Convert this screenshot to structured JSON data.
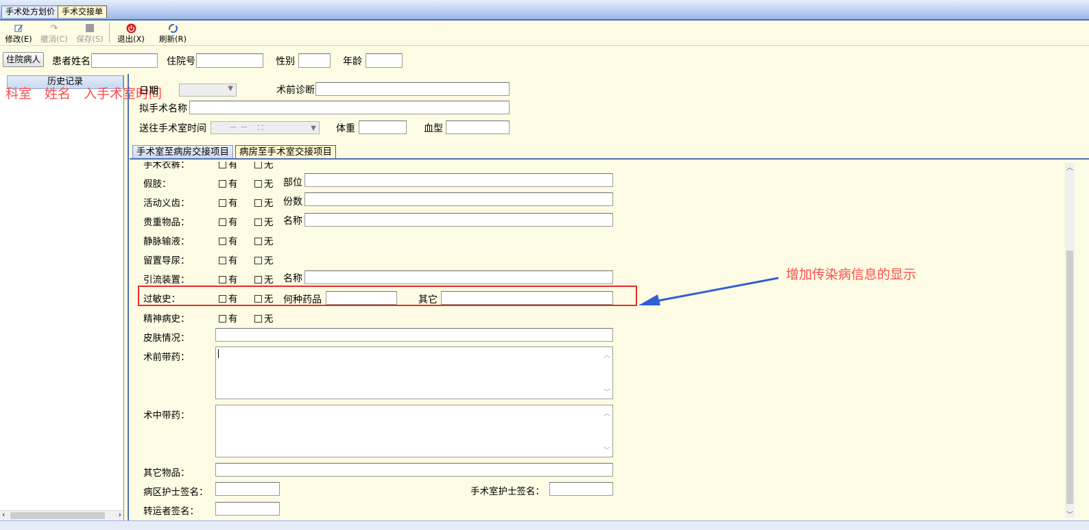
{
  "top_tabs": [
    {
      "label": "手术处方划价",
      "active": false
    },
    {
      "label": "手术交接单",
      "active": true
    }
  ],
  "toolbar": {
    "edit": {
      "label": "修改(E)",
      "icon": "edit-icon"
    },
    "undo": {
      "label": "撤消(C)",
      "icon": "undo-icon"
    },
    "save": {
      "label": "保存(S)",
      "icon": "save-icon"
    },
    "exit": {
      "label": "退出(X)",
      "icon": "power-icon"
    },
    "refresh": {
      "label": "刷新(R)",
      "icon": "refresh-icon"
    }
  },
  "patient_bar": {
    "inpatient_button": "住院病人",
    "name_label": "患者姓名",
    "admission_no_label": "住院号",
    "gender_label": "性别",
    "age_label": "年龄",
    "name_value": "",
    "admission_no_value": "",
    "gender_value": "",
    "age_value": ""
  },
  "history": {
    "header": "历史记录",
    "overlay_columns": "科室　姓名　入手术室时间"
  },
  "header_form": {
    "date_label": "日期",
    "preop_diagnosis_label": "术前诊断",
    "planned_surgery_label": "拟手术名称",
    "send_time_label": "送往手术室时间",
    "send_time_value": "－ －　：：",
    "weight_label": "体重",
    "blood_type_label": "血型"
  },
  "sub_tabs": [
    {
      "label": "手术室至病房交接项目",
      "active": false
    },
    {
      "label": "病房至手术室交接项目",
      "active": true
    }
  ],
  "options": {
    "yes": "有",
    "no": "无"
  },
  "rows": {
    "clothing": "手术衣裤：",
    "prosthesis": "假肢：",
    "prosthesis_extra": "部位",
    "dentures": "活动义齿：",
    "dentures_extra": "份数",
    "valuables": "贵重物品：",
    "valuables_extra": "名称",
    "iv": "静脉输液：",
    "catheter": "留置导尿：",
    "drainage": "引流装置：",
    "drainage_extra": "名称",
    "allergy": "过敏史：",
    "allergy_drug": "何种药品",
    "allergy_other": "其它",
    "psych": "精神病史：",
    "skin": "皮肤情况：",
    "preop_meds": "术前带药：",
    "intraop_meds": "术中带药：",
    "other_items": "其它物品：",
    "ward_nurse": "病区护士签名：",
    "or_nurse": "手术室护士签名：",
    "transporter": "转运者签名："
  },
  "annotation": {
    "text": "增加传染病信息的显示",
    "color": "#e8292b"
  }
}
